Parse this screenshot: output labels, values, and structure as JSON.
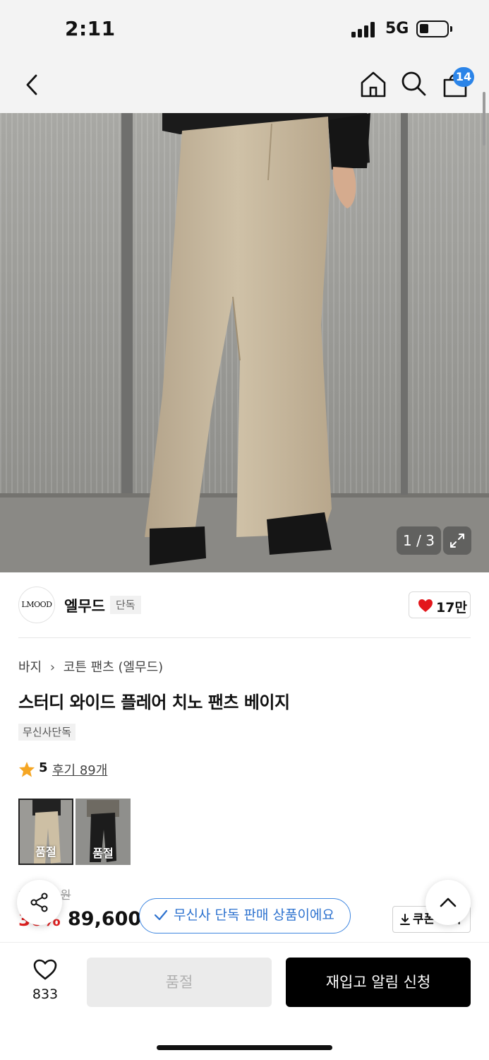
{
  "status_bar": {
    "time": "2:11",
    "network": "5G"
  },
  "nav": {
    "cart_count": "14"
  },
  "gallery": {
    "counter": "1 / 3"
  },
  "brand": {
    "name": "엘무드",
    "logo_text": "LMOOD",
    "badge": "단독",
    "likes": "17만"
  },
  "breadcrumb": {
    "category": "바지",
    "sub": "코튼 팬츠 (엘무드)"
  },
  "product": {
    "title": "스터디 와이드 플레어 치노 팬츠 베이지",
    "tag": "무신사단독",
    "rating": "5",
    "reviews": "후기 89개"
  },
  "options": [
    {
      "label": "품절"
    },
    {
      "label": "품절"
    }
  ],
  "price": {
    "original": "1__,_00원",
    "discount": "30%",
    "sale": "89,600"
  },
  "coupon_label": "쿠폰 받기",
  "toast": "무신사 단독 판매 상품이에요",
  "bottom_bar": {
    "wish_count": "833",
    "sold_out": "품절",
    "restock": "재입고 알림 신청"
  }
}
